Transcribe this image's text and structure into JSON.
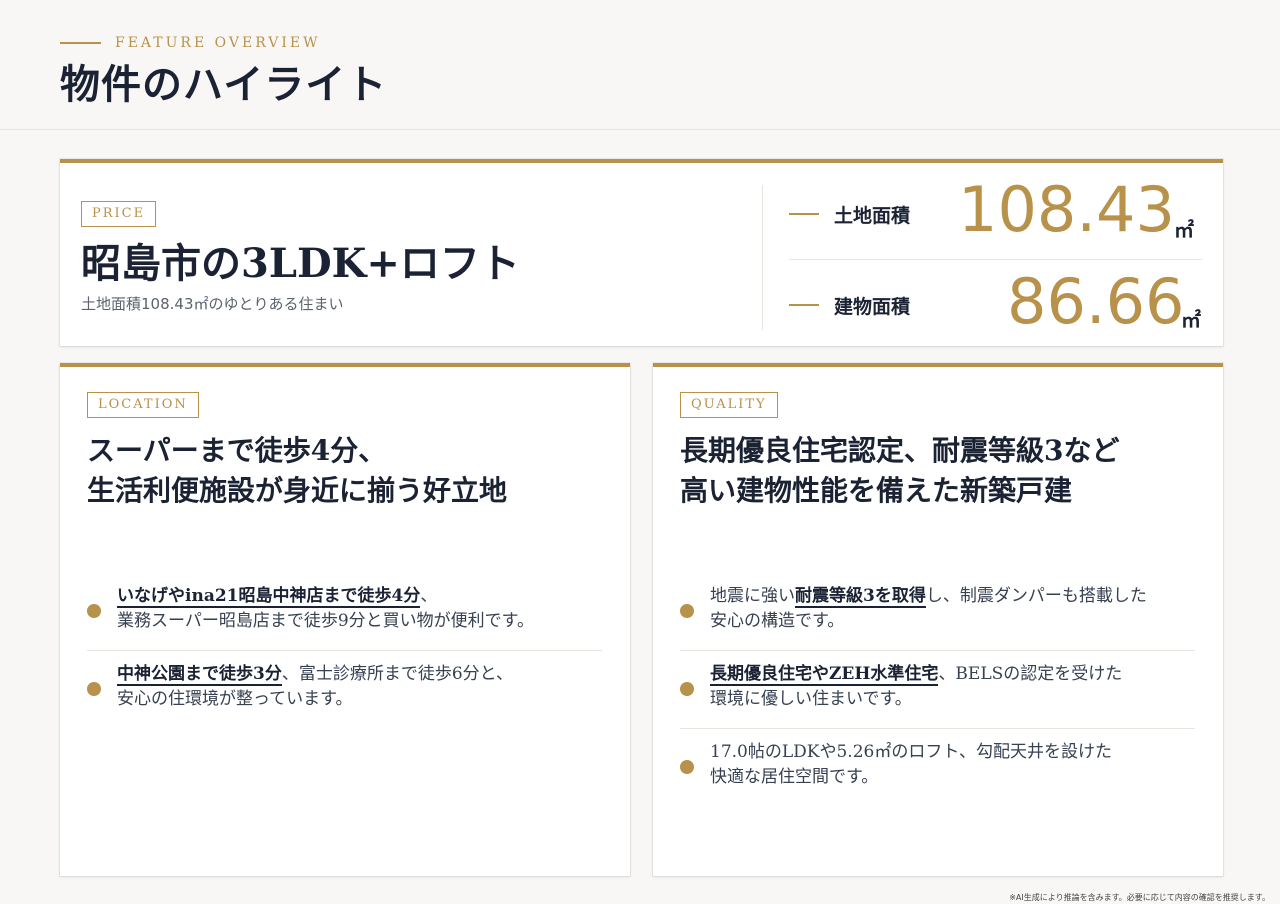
{
  "header": {
    "eyebrow": "FEATURE OVERVIEW",
    "title": "物件のハイライト"
  },
  "price": {
    "tag": "PRICE",
    "title": "昭島市の3LDK+ロフト",
    "subtitle": "土地面積108.43㎡のゆとりある住まい",
    "stats": [
      {
        "label": "土地面積",
        "value": "108.43",
        "unit": "㎡"
      },
      {
        "label": "建物面積",
        "value": "86.66",
        "unit": "㎡"
      }
    ]
  },
  "location": {
    "tag": "LOCATION",
    "heading": [
      "スーパーまで徒歩4分、",
      "生活利便施設が身近に揃う好立地"
    ],
    "items": [
      {
        "highlight": "いなげやina21昭島中神店まで徒歩4分",
        "rest": "、",
        "line2": "業務スーパー昭島店まで徒歩9分と買い物が便利です。"
      },
      {
        "highlight": "中神公園まで徒歩3分",
        "rest": "、富士診療所まで徒歩6分と、",
        "line2": "安心の住環境が整っています。"
      }
    ]
  },
  "quality": {
    "tag": "QUALITY",
    "heading": [
      "長期優良住宅認定、耐震等級3など",
      "高い建物性能を備えた新築戸建"
    ],
    "items": [
      {
        "pre": "地震に強い",
        "highlight": "耐震等級3を取得",
        "rest": "し、制震ダンパーも搭載した",
        "line2": "安心の構造です。"
      },
      {
        "pre": "",
        "highlight": "長期優良住宅やZEH水準住宅",
        "rest": "、BELSの認定を受けた",
        "line2": "環境に優しい住まいです。"
      },
      {
        "pre": "17.0帖のLDKや5.26㎡のロフト、勾配天井を設けた",
        "highlight": "",
        "rest": "",
        "line2": "快適な居住空間です。"
      }
    ]
  },
  "footnote": "※AI生成により推論を含みます。必要に応じて内容の確認を推奨します。",
  "colors": {
    "accent": "#b8924a",
    "navy": "#1a2233"
  }
}
